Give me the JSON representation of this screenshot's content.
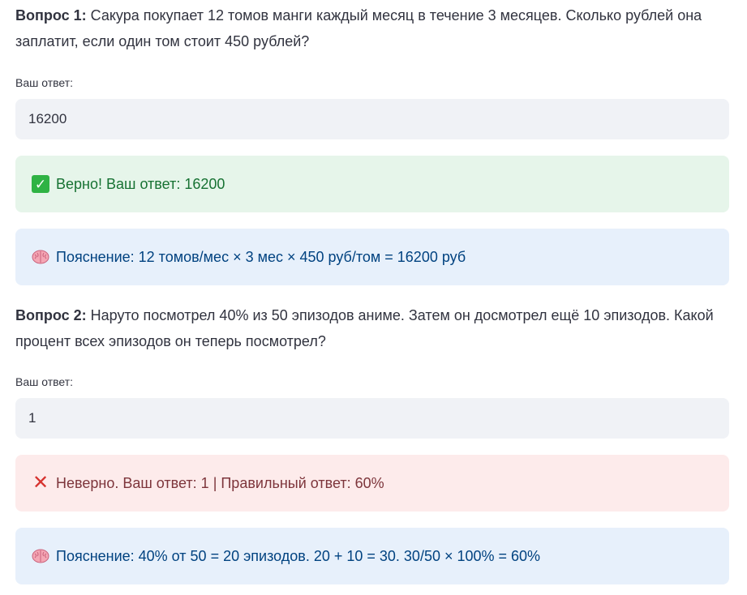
{
  "questions": [
    {
      "prefix": "Вопрос 1:",
      "text": " Сакура покупает 12 томов манги каждый месяц в течение 3 месяцев. Сколько рублей она заплатит, если один том стоит 450 рублей?",
      "answer_label": "Ваш ответ:",
      "answer_value": "16200",
      "result_icon": "check-mark-icon",
      "result_text": "Верно! Ваш ответ: 16200",
      "explanation_icon": "brain-icon",
      "explanation_text": "Пояснение: 12 томов/мес × 3 мес × 450 руб/том = 16200 руб"
    },
    {
      "prefix": "Вопрос 2:",
      "text": " Наруто посмотрел 40% из 50 эпизодов аниме. Затем он досмотрел ещё 10 эпизодов. Какой процент всех эпизодов он теперь посмотрел?",
      "answer_label": "Ваш ответ:",
      "answer_value": "1",
      "result_icon": "cross-mark-icon",
      "result_text": "Неверно. Ваш ответ: 1 | Правильный ответ: 60%",
      "explanation_icon": "brain-icon",
      "explanation_text": "Пояснение: 40% от 50 = 20 эпизодов. 20 + 10 = 30. 30/50 × 100% = 60%"
    }
  ],
  "colors": {
    "success_bg": "#e6f5ea",
    "success_text": "#177233",
    "error_bg": "#fdebeb",
    "error_text": "#7d353b",
    "info_bg": "#e7f0fb",
    "info_text": "#004280",
    "input_bg": "#f0f2f6"
  }
}
